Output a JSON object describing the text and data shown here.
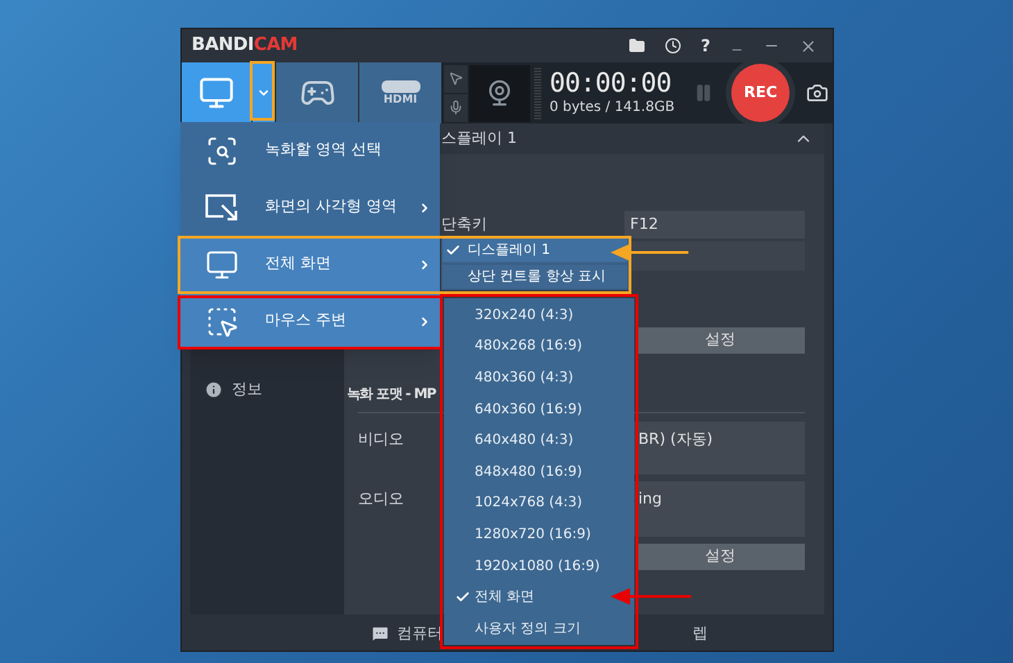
{
  "app": {
    "logo_main": "BANDI",
    "logo_accent": "CAM",
    "help_label": "?"
  },
  "modes": [
    {
      "kind": "screen",
      "selected": true
    },
    {
      "kind": "game",
      "selected": false
    },
    {
      "kind": "hdmi",
      "selected": false,
      "label": "HDMI"
    }
  ],
  "recorder": {
    "timer": "00:00:00",
    "storage": "0 bytes / 141.8GB",
    "rec_label": "REC"
  },
  "content": {
    "header": "스플레이 1",
    "hotkey_label": "단축키",
    "hotkey_value": "F12",
    "settings_button": "설정",
    "format_title": "녹화 포맷 - MP",
    "video_label": "비디오",
    "video_value": "BR) (자동)",
    "audio_label": "오디오",
    "audio_value": "ing",
    "settings_button_2": "설정"
  },
  "sidebar": {
    "items": [
      {
        "label": "정보"
      }
    ]
  },
  "status_bar": {
    "texts": [
      "컴퓨터",
      "렙"
    ]
  },
  "menu": {
    "items": [
      {
        "kind": "region",
        "label": "녹화할 영역 선택",
        "submenu": false,
        "selected": false
      },
      {
        "kind": "rectangle",
        "label": "화면의 사각형 영역",
        "submenu": true,
        "selected": false
      },
      {
        "kind": "fullscreen",
        "label": "전체 화면",
        "submenu": true,
        "selected": true
      },
      {
        "kind": "mouse",
        "label": "마우스 주변",
        "submenu": true,
        "selected": true
      }
    ]
  },
  "fullscreen_submenu": [
    {
      "label": "디스플레이 1",
      "checked": true,
      "selected": true
    },
    {
      "label": "상단 컨트롤 항상 표시",
      "checked": false,
      "selected": false
    }
  ],
  "mouse_submenu": [
    {
      "label": "320x240 (4:3)",
      "checked": false
    },
    {
      "label": "480x268 (16:9)",
      "checked": false
    },
    {
      "label": "480x360 (4:3)",
      "checked": false
    },
    {
      "label": "640x360 (16:9)",
      "checked": false
    },
    {
      "label": "640x480 (4:3)",
      "checked": false
    },
    {
      "label": "848x480 (16:9)",
      "checked": false
    },
    {
      "label": "1024x768 (4:3)",
      "checked": false
    },
    {
      "label": "1280x720 (16:9)",
      "checked": false
    },
    {
      "label": "1920x1080 (16:9)",
      "checked": false
    },
    {
      "label": "전체 화면",
      "checked": true
    },
    {
      "label": "사용자 정의 크기",
      "checked": false
    }
  ],
  "annotations": [
    {
      "kind": "frame",
      "color": "#f5a623"
    },
    {
      "kind": "frame",
      "color": "#f5a623"
    },
    {
      "kind": "arrow",
      "color": "#f5a623"
    },
    {
      "kind": "frame",
      "color": "#e80000"
    },
    {
      "kind": "frame",
      "color": "#e80000"
    },
    {
      "kind": "arrow",
      "color": "#e80000"
    }
  ]
}
